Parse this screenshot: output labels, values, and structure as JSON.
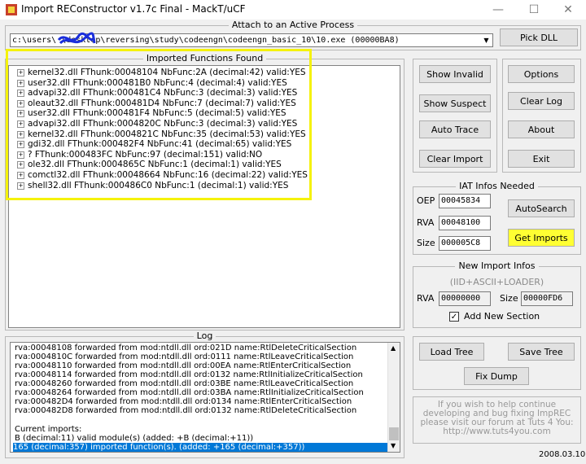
{
  "window": {
    "title": "Import REConstructor v1.7c Final - MackT/uCF",
    "min_icon": "minimize-icon",
    "max_icon": "maximize-icon",
    "close_icon": "close-icon"
  },
  "attach": {
    "group_title": "Attach to an Active Process",
    "process_value": "c:\\users\\         \\desktop\\reversing\\study\\codeengn\\codeengn_basic_10\\10.exe (00000BA8)",
    "pick_dll": "Pick DLL"
  },
  "imported": {
    "group_title": "Imported Functions Found",
    "items": [
      "kernel32.dll FThunk:00048104 NbFunc:2A (decimal:42) valid:YES",
      "user32.dll FThunk:000481B0 NbFunc:4 (decimal:4) valid:YES",
      "advapi32.dll FThunk:000481C4 NbFunc:3 (decimal:3) valid:YES",
      "oleaut32.dll FThunk:000481D4 NbFunc:7 (decimal:7) valid:YES",
      "user32.dll FThunk:000481F4 NbFunc:5 (decimal:5) valid:YES",
      "advapi32.dll FThunk:0004820C NbFunc:3 (decimal:3) valid:YES",
      "kernel32.dll FThunk:0004821C NbFunc:35 (decimal:53) valid:YES",
      "gdi32.dll FThunk:000482F4 NbFunc:41 (decimal:65) valid:YES",
      "? FThunk:000483FC NbFunc:97 (decimal:151) valid:NO",
      "ole32.dll FThunk:0004865C NbFunc:1 (decimal:1) valid:YES",
      "comctl32.dll FThunk:00048664 NbFunc:16 (decimal:22) valid:YES",
      "shell32.dll FThunk:000486C0 NbFunc:1 (decimal:1) valid:YES"
    ],
    "highlight_color": "#f5f20c"
  },
  "buttons": {
    "show_invalid": "Show Invalid",
    "show_suspect": "Show Suspect",
    "auto_trace": "Auto Trace",
    "clear_import": "Clear Import",
    "options": "Options",
    "clear_log": "Clear Log",
    "about": "About",
    "exit": "Exit",
    "load_tree": "Load Tree",
    "save_tree": "Save Tree",
    "fix_dump": "Fix Dump"
  },
  "iat": {
    "group_title": "IAT Infos Needed",
    "oep_label": "OEP",
    "oep_value": "00045834",
    "rva_label": "RVA",
    "rva_value": "00048100",
    "size_label": "Size",
    "size_value": "000005C8",
    "autosearch": "AutoSearch",
    "get_imports": "Get Imports"
  },
  "new_import": {
    "group_title": "New Import Infos",
    "subtitle": "(IID+ASCII+LOADER)",
    "rva_label": "RVA",
    "rva_value": "00000000",
    "size_label": "Size",
    "size_value": "00000FD6",
    "add_section_label": "Add New Section",
    "add_section_checked": true
  },
  "log": {
    "group_title": "Log",
    "lines": [
      "rva:00048108 forwarded from mod:ntdll.dll ord:021D name:RtlDeleteCriticalSection",
      "rva:0004810C forwarded from mod:ntdll.dll ord:0111 name:RtlLeaveCriticalSection",
      "rva:00048110 forwarded from mod:ntdll.dll ord:00EA name:RtlEnterCriticalSection",
      "rva:00048114 forwarded from mod:ntdll.dll ord:0132 name:RtlInitializeCriticalSection",
      "rva:00048260 forwarded from mod:ntdll.dll ord:03BE name:RtlLeaveCriticalSection",
      "rva:00048264 forwarded from mod:ntdll.dll ord:03BA name:RtlInitializeCriticalSection",
      "rva:000482D4 forwarded from mod:ntdll.dll ord:0134 name:RtlEnterCriticalSection",
      "rva:000482D8 forwarded from mod:ntdll.dll ord:0132 name:RtlDeleteCriticalSection"
    ],
    "current_imports": "Current imports:",
    "modules_line": "B (decimal:11) valid module(s) (added: +B (decimal:+11))",
    "functions_line": "165 (decimal:357) imported function(s). (added: +165 (decimal:+357))"
  },
  "credit": {
    "line1": "If you wish to help continue",
    "line2": "developing and bug fixing ImpREC",
    "line3": "please visit our forum at Tuts 4 You:",
    "line4": "http://www.tuts4you.com"
  },
  "date": "2008.03.10"
}
